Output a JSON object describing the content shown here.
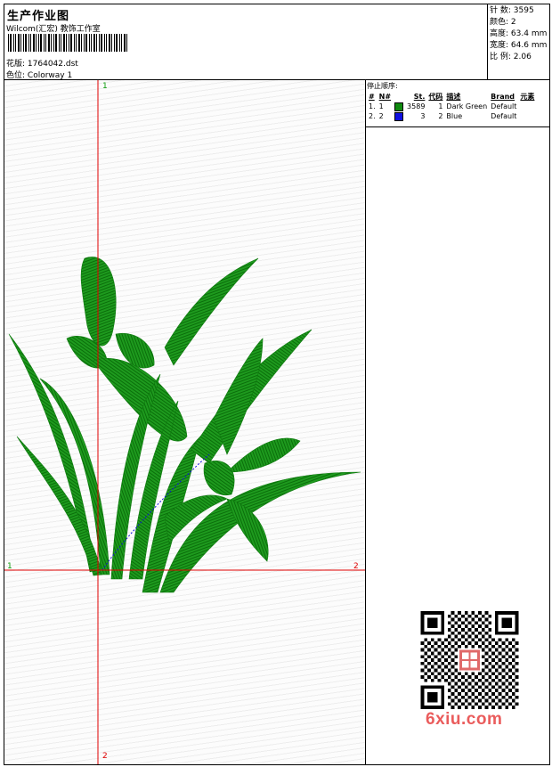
{
  "header": {
    "title": "生产作业图",
    "studio": "Wilcom(汇宏) 教饰工作室",
    "design_label": "花版:",
    "design_value": "1764042.dst",
    "colorway_label": "色位:",
    "colorway_value": "Colorway 1"
  },
  "stats": {
    "stitches_label": "针 数:",
    "stitches": "3595",
    "colors_label": "颜色:",
    "colors": "2",
    "height_label": "高度:",
    "height": "63.4 mm",
    "width_label": "宽度:",
    "width": "64.6 mm",
    "ratio_label": "比 例:",
    "ratio": "2.06"
  },
  "stop_sequence": {
    "title": "停止顺序:",
    "columns": [
      "#",
      "N#",
      "St.",
      "代码",
      "描述",
      "Brand",
      "元素"
    ],
    "rows": [
      {
        "idx": "1.",
        "n": "1",
        "color": "#108a10",
        "st": "3589",
        "code": "1",
        "desc": "Dark Green",
        "brand": "Default"
      },
      {
        "idx": "2.",
        "n": "2",
        "color": "#1010e0",
        "st": "3",
        "code": "2",
        "desc": "Blue",
        "brand": "Default"
      }
    ]
  },
  "axes": {
    "top": "1",
    "bottom": "2",
    "left": "1",
    "right": "2"
  },
  "colors": {
    "thread_green": "#108a10",
    "thread_blue": "#1010e0",
    "axis_red": "#e00000",
    "watermark": "#ea5c5c"
  },
  "watermark": {
    "url": "6xiu.com"
  }
}
